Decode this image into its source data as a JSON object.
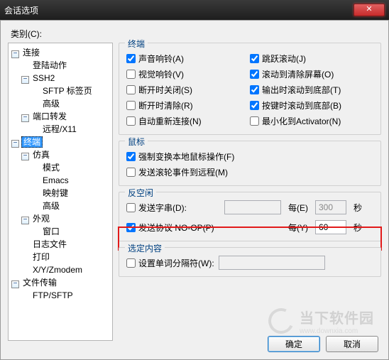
{
  "window": {
    "title": "会话选项"
  },
  "category_label": "类别(C):",
  "tree": {
    "connection": "连接",
    "login_action": "登陆动作",
    "ssh2": "SSH2",
    "sftp_tab": "SFTP 标签页",
    "ssh2_advanced": "高级",
    "port_forward": "端口转发",
    "remote_x11": "远程/X11",
    "terminal": "终端",
    "emulation": "仿真",
    "mode": "模式",
    "emacs": "Emacs",
    "keymap": "映射键",
    "advanced": "高级",
    "appearance": "外观",
    "window": "窗口",
    "logfile": "日志文件",
    "printing": "打印",
    "xy_zmodem": "X/Y/Zmodem",
    "file_transfer": "文件传输",
    "ftp_sftp": "FTP/SFTP"
  },
  "group_terminal": {
    "legend": "终端",
    "sound_bell": {
      "label": "声音响铃(A)",
      "checked": true
    },
    "jump_scroll": {
      "label": "跳跃滚动(J)",
      "checked": true
    },
    "visual_bell": {
      "label": "视觉响铃(V)",
      "checked": false
    },
    "clear_on_scroll": {
      "label": "滚动到清除屏幕(O)",
      "checked": true
    },
    "close_on_disc": {
      "label": "断开时关闭(S)",
      "checked": false
    },
    "scroll_bottom_out": {
      "label": "输出时滚动到底部(T)",
      "checked": true
    },
    "clear_on_disc": {
      "label": "断开时清除(R)",
      "checked": false
    },
    "scroll_bottom_key": {
      "label": "按键时滚动到底部(B)",
      "checked": true
    },
    "auto_reconnect": {
      "label": "自动重新连接(N)",
      "checked": false
    },
    "min_to_activator": {
      "label": "最小化到Activator(N)",
      "checked": false
    }
  },
  "group_mouse": {
    "legend": "鼠标",
    "force_local_mouse": {
      "label": "强制变换本地鼠标操作(F)",
      "checked": true
    },
    "send_wheel_remote": {
      "label": "发送滚轮事件到远程(M)",
      "checked": false
    }
  },
  "group_antiidle": {
    "legend": "反空闲",
    "send_string": {
      "label": "发送字串(D):",
      "checked": false
    },
    "string_every_label": "每(E)",
    "string_interval": "300",
    "seconds1": "秒",
    "send_noop": {
      "label": "发送协议 NO-OP(P)",
      "checked": true
    },
    "noop_every_label": "每(Y)",
    "noop_interval": "60",
    "seconds2": "秒"
  },
  "group_selection": {
    "legend": "选定内容",
    "word_delim": {
      "label": "设置单词分隔符(W):",
      "checked": false
    }
  },
  "buttons": {
    "ok": "确定",
    "cancel": "取消"
  },
  "watermark": {
    "text": "当下软件园",
    "url": "www.downxia.com"
  },
  "glyphs": {
    "minus": "−",
    "x": "✕"
  }
}
